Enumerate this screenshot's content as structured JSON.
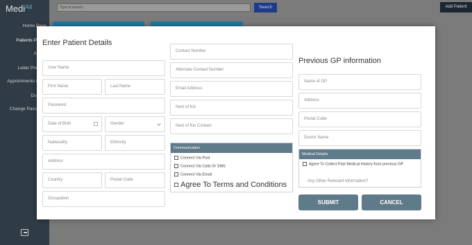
{
  "app": {
    "logo_main": "Medi",
    "logo_accent": "All",
    "logo_suffix": ""
  },
  "sidebar": {
    "items": [
      {
        "label": "Home Page"
      },
      {
        "label": "Patients Profile"
      },
      {
        "label": "Admin"
      },
      {
        "label": "Letter Preview"
      },
      {
        "label": "Appointments Diary"
      },
      {
        "label": "Doctors"
      },
      {
        "label": "Change Password"
      }
    ]
  },
  "topbar": {
    "search_placeholder": "Type to search...",
    "search_button": "Search",
    "add_patient": "Add Patient"
  },
  "modal": {
    "title": "Enter Patient Details",
    "patient_fields": {
      "user_name": "User Name",
      "first_name": "First Name",
      "last_name": "Last Name",
      "password": "Password",
      "dob": "Date of Birth",
      "gender": "Gender",
      "nationality": "Nationality",
      "ethnicity": "Ethnicity",
      "address": "Address",
      "country": "Country",
      "postal_code": "Postal Code",
      "occupation": "Occupation"
    },
    "contact_fields": {
      "contact_number": "Contact Number",
      "alt_contact": "Alternate Contact Number",
      "email": "Email Address",
      "next_of_kin": "Next of Kin",
      "next_of_kin_contact": "Next of Kin Contact"
    },
    "communication": {
      "heading": "Communication",
      "post": "Connect Via Post",
      "calls": "Connect Via Calls Or SMS",
      "email": "Connect Via Email",
      "terms": "Agree To Terms and Conditions"
    },
    "gp": {
      "title": "Previous GP information",
      "name": "Name of GP",
      "address": "Address",
      "postal_code": "Postal Code",
      "doctor_name": "Doctor Name"
    },
    "medical": {
      "heading": "Medical Details",
      "agree": "Agree To Collect Past Medical History from previous GP",
      "other_placeholder": "Any Other Relevant Information?"
    },
    "buttons": {
      "submit": "SUBMIT",
      "cancel": "CANCEL"
    }
  }
}
